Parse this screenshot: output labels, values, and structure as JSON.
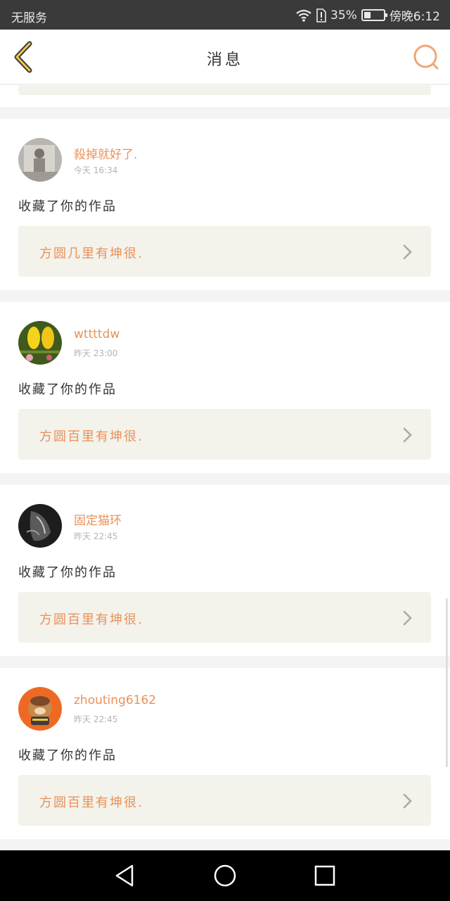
{
  "status_bar": {
    "carrier": "无服务",
    "battery": "35%",
    "time": "傍晚6:12",
    "battery_level": 0.35
  },
  "header": {
    "title": "消息"
  },
  "notifications": [
    {
      "user": "殺掉就好了.",
      "time": "今天 16:34",
      "action": "收藏了你的作品",
      "work_title": "方圆几里有坤很.",
      "avatar_color": "#b9b6b1"
    },
    {
      "user": "wttttdw",
      "time": "昨天 23:00",
      "action": "收藏了你的作品",
      "work_title": "方圆百里有坤很.",
      "avatar_color": "#3f5a1c"
    },
    {
      "user": "固定猫环",
      "time": "昨天 22:45",
      "action": "收藏了你的作品",
      "work_title": "方圆百里有坤很.",
      "avatar_color": "#1d1d1d"
    },
    {
      "user": "zhouting6162",
      "time": "昨天 22:45",
      "action": "收藏了你的作品",
      "work_title": "方圆百里有坤很.",
      "avatar_color": "#ee6a24"
    }
  ],
  "colors": {
    "accent": "#e9915a",
    "status_bar_bg": "#3a3a3a",
    "card_bg": "#f3f2eb"
  }
}
